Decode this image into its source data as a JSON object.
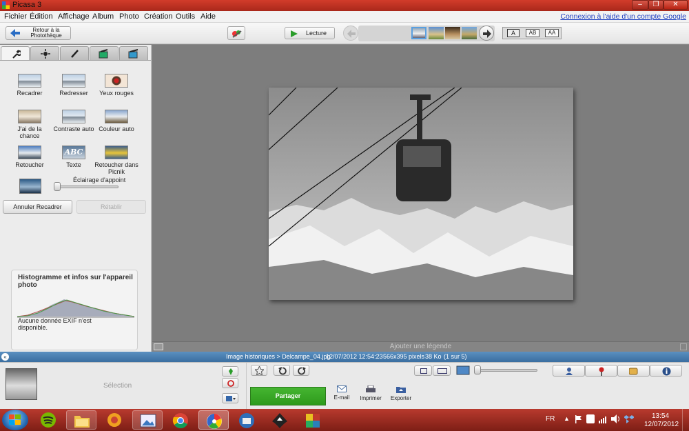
{
  "window": {
    "title": "Picasa 3",
    "controls": [
      "minimize",
      "maximize",
      "close"
    ]
  },
  "menu": {
    "items": [
      "Fichier",
      "Édition",
      "Affichage",
      "Album",
      "Photo",
      "Création",
      "Outils",
      "Aide"
    ],
    "login_link": "Connexion à l'aide d'un compte Google"
  },
  "toolbar": {
    "back_label_line1": "Retour à la",
    "back_label_line2": "Photothèque",
    "play_label": "Lecture",
    "caption_modes": [
      "A",
      "AB",
      "AA"
    ]
  },
  "edit_tabs": [
    "wrench-icon",
    "sun-icon",
    "brush-icon",
    "bucket-icon",
    "pen-icon"
  ],
  "tools": [
    {
      "label": "Recadrer"
    },
    {
      "label": "Redresser"
    },
    {
      "label": "Yeux rouges"
    },
    {
      "label": "J'ai de la chance"
    },
    {
      "label": "Contraste auto"
    },
    {
      "label": "Couleur auto"
    },
    {
      "label": "Retoucher"
    },
    {
      "label": "Texte"
    },
    {
      "label": "Retoucher dans Picnik"
    }
  ],
  "fill_light": {
    "label": "Éclairage d'appoint",
    "value": 0
  },
  "actions": {
    "undo_crop": "Annuler Recadrer",
    "restore": "Rétablir"
  },
  "histogram": {
    "title": "Histogramme et infos sur l'appareil photo",
    "no_exif": "Aucune donnée EXIF n'est disponible."
  },
  "caption_placeholder": "Ajouter une légende",
  "info": {
    "path": "Image historiques > Delcampe_04.jpg",
    "datetime": "12/07/2012 12:54:23",
    "dimensions": "566x395 pixels",
    "size": "38 Ko",
    "position": "(1 sur 5)"
  },
  "tray": {
    "selection_label": "Sélection",
    "share_label": "Partager",
    "email_label": "E-mail",
    "print_label": "Imprimer",
    "export_label": "Exporter"
  },
  "taskbar": {
    "lang": "FR",
    "time": "13:54",
    "date": "12/07/2012",
    "apps": [
      "spotify-icon",
      "explorer-icon",
      "media-icon",
      "picture-viewer-icon",
      "chrome-icon",
      "picasa-icon",
      "thunderbird-icon",
      "inkscape-icon",
      "puzzle-icon"
    ]
  },
  "colors": {
    "share_green": "#2e9a1c",
    "title_red": "#c0392b",
    "info_blue": "#4a7fb2"
  }
}
